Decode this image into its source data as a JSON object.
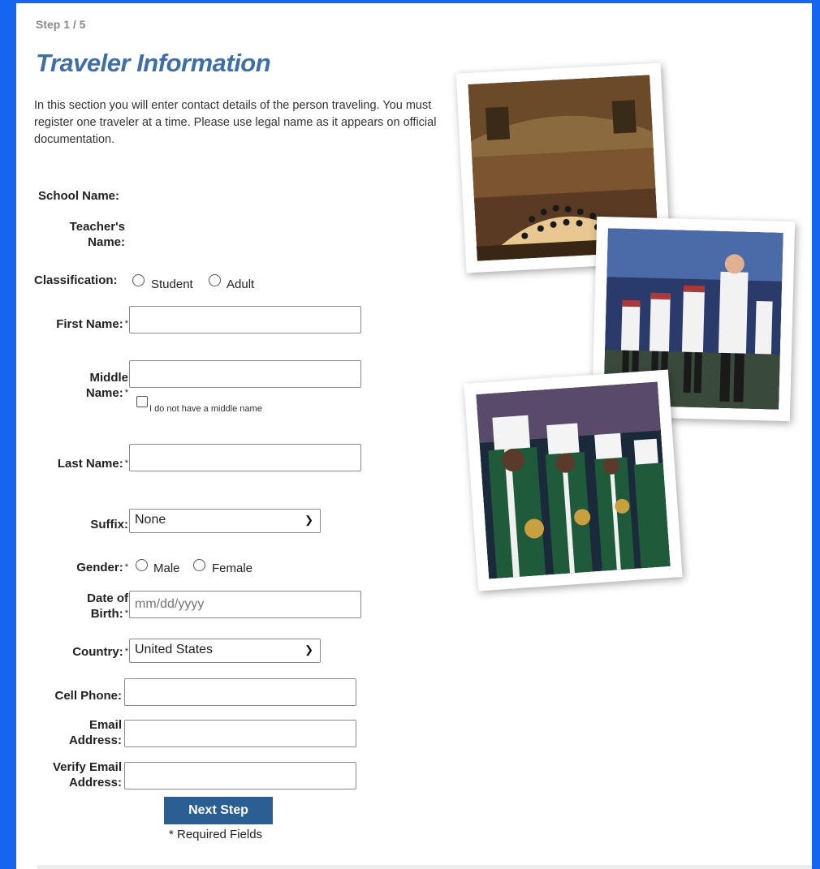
{
  "step_label": "Step 1 / 5",
  "page_title": "Traveler Information",
  "intro": "In this section you will enter contact details of the person traveling. You must register one traveler at a time. Please use legal name as it appears on official documentation.",
  "labels": {
    "school_name": "School Name:",
    "teacher_name_1": "Teacher's",
    "teacher_name_2": "Name:",
    "classification": "Classification:",
    "first_name": "First Name:",
    "middle_name_1": "Middle",
    "middle_name_2": "Name:",
    "last_name": "Last Name:",
    "suffix": "Suffix:",
    "gender": "Gender:",
    "dob_1": "Date of",
    "dob_2": "Birth:",
    "country": "Country:",
    "cell_phone": "Cell Phone:",
    "email_1": "Email",
    "email_2": "Address:",
    "verify_email_1": "Verify Email",
    "verify_email_2": "Address:"
  },
  "required_mark": "*",
  "classification_options": [
    "Student",
    "Adult"
  ],
  "gender_options": [
    "Male",
    "Female"
  ],
  "no_middle_name": "I do not have a middle name",
  "fields": {
    "first_name": "",
    "middle_name": "",
    "last_name": "",
    "dob_placeholder": "mm/dd/yyyy",
    "cell_phone": "",
    "email": "",
    "verify_email": ""
  },
  "suffix_selected": "None",
  "country_selected": "United States",
  "next_button": "Next Step",
  "required_note": "* Required Fields",
  "colors": {
    "frame": "#1565f0",
    "title": "#3f6fa6",
    "button": "#2b5f94"
  }
}
